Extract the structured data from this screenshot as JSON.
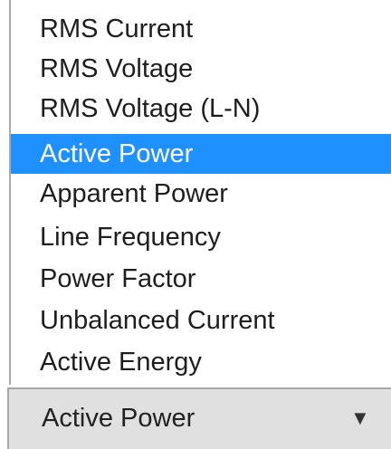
{
  "dropdown": {
    "options": [
      {
        "label": "RMS Current"
      },
      {
        "label": "RMS Voltage"
      },
      {
        "label": "RMS Voltage (L-N)"
      },
      {
        "label": "Active Power"
      },
      {
        "label": "Apparent Power"
      },
      {
        "label": "Line Frequency"
      },
      {
        "label": "Power Factor"
      },
      {
        "label": "Unbalanced Current"
      },
      {
        "label": "Active Energy"
      }
    ],
    "highlighted": "Active Power",
    "highlight_color": "#1e90ff",
    "selected_value": "Active Power",
    "arrow_icon": "triangle-down-icon"
  }
}
